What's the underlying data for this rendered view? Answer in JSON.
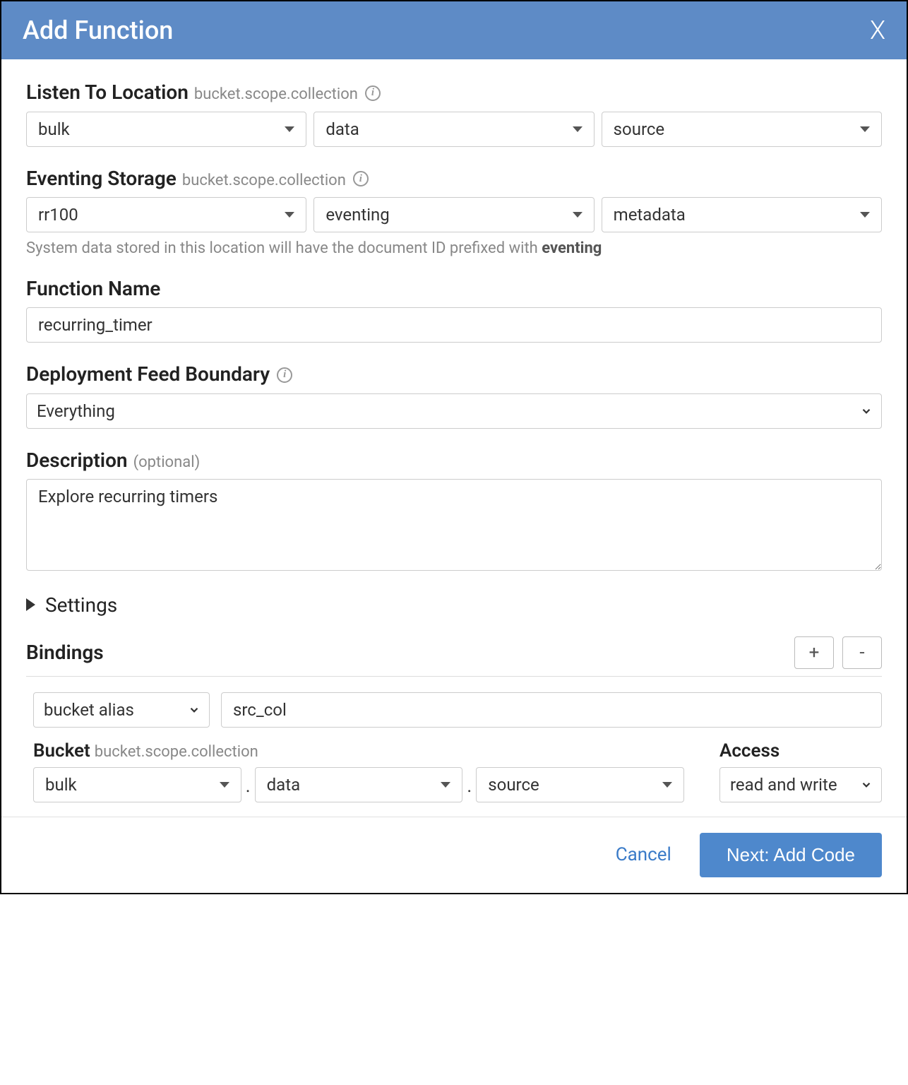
{
  "header": {
    "title": "Add Function",
    "close": "X"
  },
  "listenTo": {
    "label": "Listen To Location",
    "hint": "bucket.scope.collection",
    "bucket": "bulk",
    "scope": "data",
    "collection": "source"
  },
  "eventingStorage": {
    "label": "Eventing Storage",
    "hint": "bucket.scope.collection",
    "bucket": "rr100",
    "scope": "eventing",
    "collection": "metadata",
    "helperPrefix": "System data stored in this location will have the document ID prefixed with ",
    "helperStrong": "eventing"
  },
  "functionName": {
    "label": "Function Name",
    "value": "recurring_timer"
  },
  "feedBoundary": {
    "label": "Deployment Feed Boundary",
    "value": "Everything"
  },
  "description": {
    "label": "Description",
    "hint": "(optional)",
    "value": "Explore recurring timers"
  },
  "settings": {
    "label": "Settings"
  },
  "bindings": {
    "title": "Bindings",
    "add": "+",
    "remove": "-",
    "row": {
      "type": "bucket alias",
      "alias": "src_col"
    },
    "bucket": {
      "label": "Bucket",
      "hint": "bucket.scope.collection",
      "bucket": "bulk",
      "scope": "data",
      "collection": "source"
    },
    "access": {
      "label": "Access",
      "value": "read and write"
    }
  },
  "footer": {
    "cancel": "Cancel",
    "next": "Next: Add Code"
  }
}
